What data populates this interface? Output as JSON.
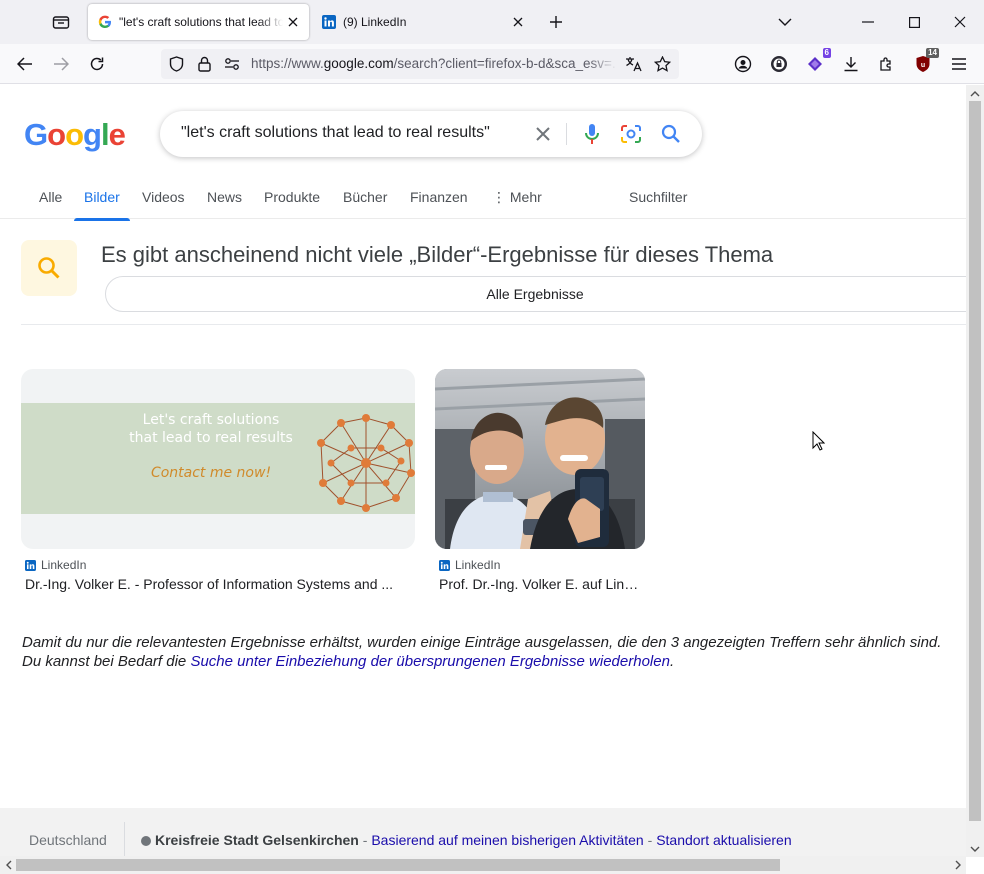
{
  "browser": {
    "tabs": [
      {
        "title": "\"let's craft solutions that lead to real results\" - Google Suche",
        "active": true,
        "favicon": "google-icon"
      },
      {
        "title": "(9) LinkedIn",
        "active": false,
        "favicon": "linkedin-icon"
      }
    ],
    "url": {
      "prefix": "https://www.",
      "host": "google.com",
      "path": "/search?client=firefox-b-d&sca_esv=..."
    },
    "extensions": [
      {
        "name": "account-icon"
      },
      {
        "name": "privacy-extension-icon"
      },
      {
        "name": "bookmark-extension-icon",
        "badge": "6",
        "badge_color": "#7542e5"
      },
      {
        "name": "downloads-icon"
      },
      {
        "name": "extensions-icon"
      },
      {
        "name": "ublock-icon",
        "badge": "14",
        "badge_color": "#5f5f5f"
      },
      {
        "name": "menu-icon"
      }
    ]
  },
  "search": {
    "logo": [
      "G",
      "o",
      "o",
      "g",
      "l",
      "e"
    ],
    "logo_colors": [
      "#4285f4",
      "#ea4335",
      "#fbbc05",
      "#4285f4",
      "#34a853",
      "#ea4335"
    ],
    "query": "\"let's craft solutions that lead to real results\"",
    "tabs": [
      {
        "label": "Alle",
        "active": false
      },
      {
        "label": "Bilder",
        "active": true
      },
      {
        "label": "Videos",
        "active": false
      },
      {
        "label": "News",
        "active": false
      },
      {
        "label": "Produkte",
        "active": false
      },
      {
        "label": "Bücher",
        "active": false
      },
      {
        "label": "Finanzen",
        "active": false
      },
      {
        "label": "⋮ Mehr",
        "active": false
      }
    ],
    "filter_label": "Suchfilter",
    "accent_color": "#1a73e8"
  },
  "notice": {
    "title": "Es gibt anscheinend nicht viele „Bilder“-Ergebnisse für dieses Thema",
    "all_results_label": "Alle Ergebnisse"
  },
  "results": [
    {
      "source": "LinkedIn",
      "title": "Dr.-Ing. Volker E. - Professor of Information Systems and ...",
      "banner_line1": "Let's craft solutions",
      "banner_line2": "that lead to real results",
      "banner_cta": "Contact me now!"
    },
    {
      "source": "LinkedIn",
      "title": "Prof. Dr.-Ing. Volker E. auf LinkedIn: ..."
    }
  ],
  "omitted": {
    "line1": "Damit du nur die relevantesten Ergebnisse erhältst, wurden einige Einträge ausgelassen, die den 3 angezeigten Treffern sehr ähnlich sind.",
    "line2_prefix": "Du kannst bei Bedarf die ",
    "line2_link": "Suche unter Einbeziehung der übersprungenen Ergebnisse wiederholen",
    "line2_suffix": "."
  },
  "footer": {
    "country": "Deutschland",
    "location": "Kreisfreie Stadt Gelsenkirchen",
    "sep1": " - ",
    "based_on": "Basierend auf meinen bisherigen Aktivitäten",
    "sep2": " - ",
    "update": "Standort aktualisieren"
  }
}
